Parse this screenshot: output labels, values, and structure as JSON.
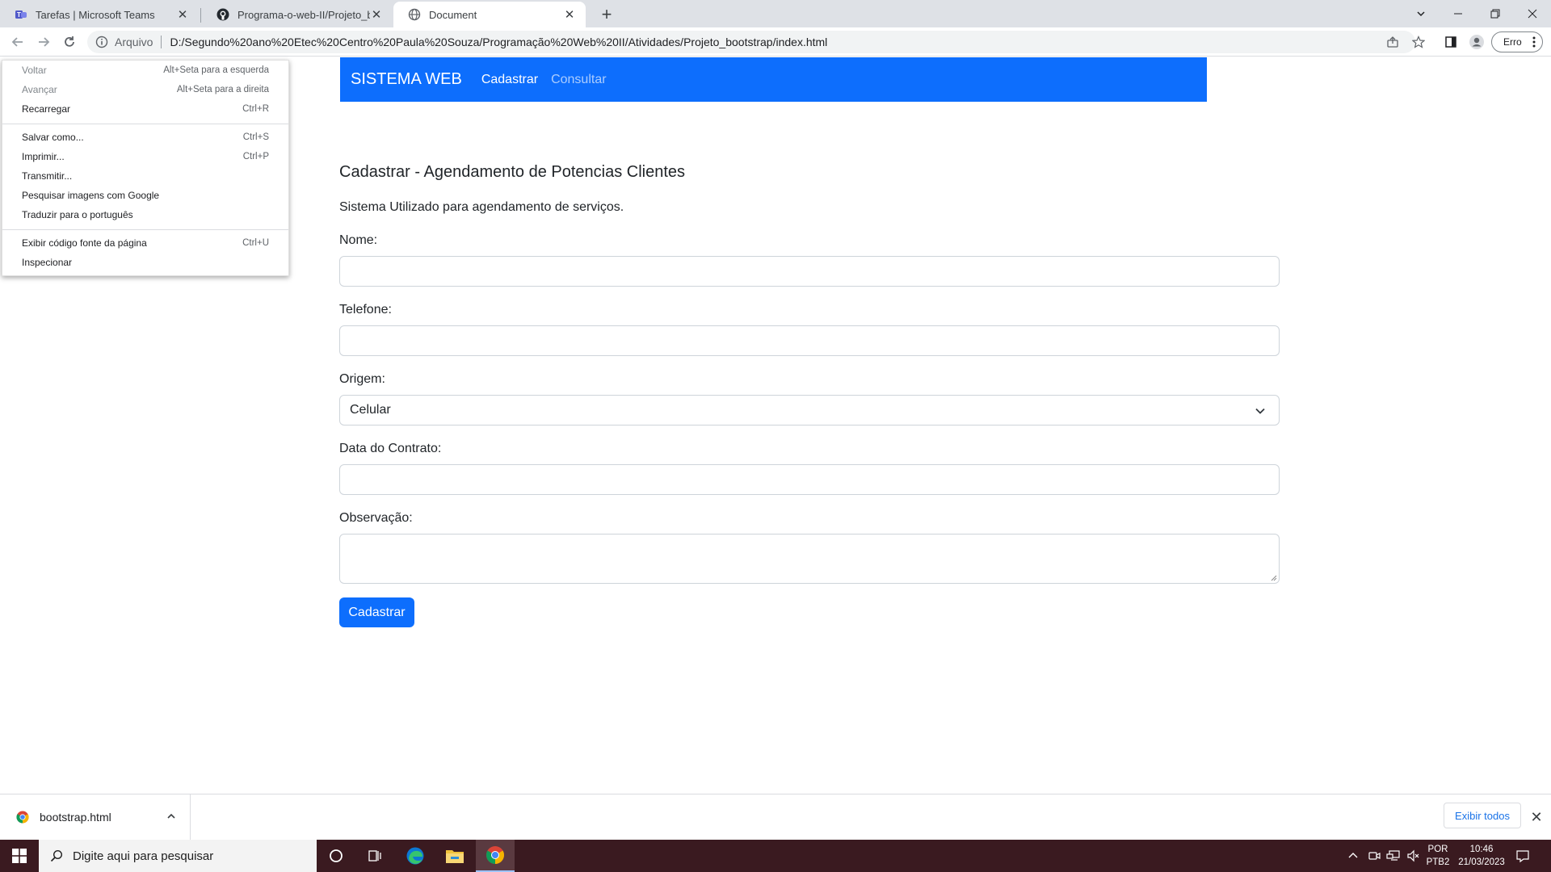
{
  "browser": {
    "tabs": [
      {
        "title": "Tarefas | Microsoft Teams",
        "active": false
      },
      {
        "title": "Programa-o-web-II/Projeto_boot",
        "active": false
      },
      {
        "title": "Document",
        "active": true
      }
    ],
    "new_tab": "+",
    "window": {
      "minimize": "—",
      "restore": "❐",
      "close": "✕",
      "tab_search": "⌄"
    },
    "address": {
      "scheme_label": "Arquivo",
      "url": "D:/Segundo%20ano%20Etec%20Centro%20Paula%20Souza/Programação%20Web%20II/Atividades/Projeto_bootstrap/index.html"
    },
    "profile_label": "Erro"
  },
  "context_menu": {
    "items": [
      {
        "label": "Voltar",
        "shortcut": "Alt+Seta para a esquerda",
        "disabled": true
      },
      {
        "label": "Avançar",
        "shortcut": "Alt+Seta para a direita",
        "disabled": true
      },
      {
        "label": "Recarregar",
        "shortcut": "Ctrl+R",
        "disabled": false
      },
      {
        "label": "Salvar como...",
        "shortcut": "Ctrl+S",
        "disabled": false
      },
      {
        "label": "Imprimir...",
        "shortcut": "Ctrl+P",
        "disabled": false
      },
      {
        "label": "Transmitir...",
        "shortcut": "",
        "disabled": false
      },
      {
        "label": "Pesquisar imagens com Google",
        "shortcut": "",
        "disabled": false
      },
      {
        "label": "Traduzir para o português",
        "shortcut": "",
        "disabled": false
      },
      {
        "label": "Exibir código fonte da página",
        "shortcut": "Ctrl+U",
        "disabled": false
      },
      {
        "label": "Inspecionar",
        "shortcut": "",
        "disabled": false
      }
    ]
  },
  "navbar": {
    "brand": "SISTEMA WEB",
    "links": [
      {
        "label": "Cadastrar",
        "active": true
      },
      {
        "label": "Consultar",
        "active": false
      }
    ],
    "color": "#0d6efd"
  },
  "form": {
    "title": "Cadastrar - Agendamento de Potencias Clientes",
    "subtitle": "Sistema Utilizado para agendamento de serviços.",
    "fields": {
      "nome": {
        "label": "Nome:",
        "value": ""
      },
      "telefone": {
        "label": "Telefone:",
        "value": ""
      },
      "origem": {
        "label": "Origem:",
        "value": "Celular"
      },
      "data": {
        "label": "Data do Contrato:",
        "value": ""
      },
      "obs": {
        "label": "Observação:",
        "value": ""
      }
    },
    "submit_label": "Cadastrar"
  },
  "download_shelf": {
    "file_name": "bootstrap.html",
    "show_all": "Exibir todos",
    "close": "✕"
  },
  "taskbar": {
    "search_placeholder": "Digite aqui para pesquisar",
    "language": "POR",
    "layout": "PTB2",
    "time": "10:46",
    "date": "21/03/2023",
    "accent": "#3a1a20"
  }
}
